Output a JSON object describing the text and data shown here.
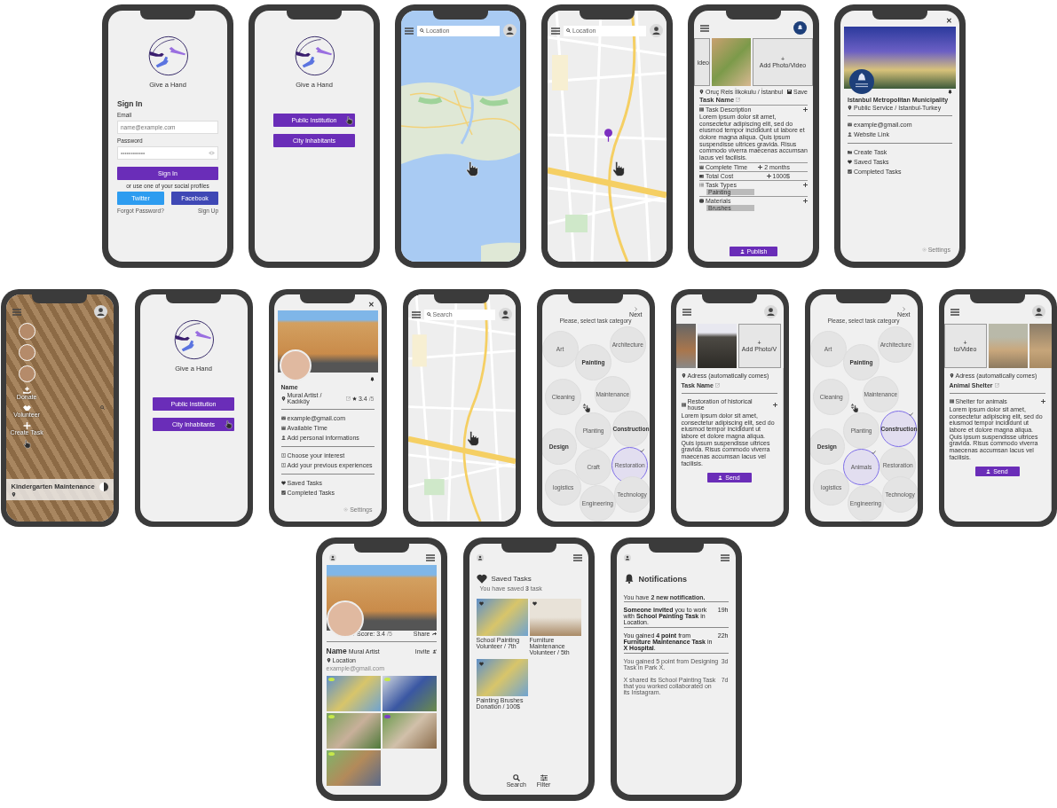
{
  "rows": [
    {
      "screens": [
        {
          "kind": "signin",
          "app_name": "Give a Hand",
          "heading": "Sign In",
          "email_label": "Email",
          "email_placeholder": "name@example.com",
          "password_label": "Password",
          "password_value": "••••••••••••",
          "submit": "Sign In",
          "social_text": "or use one of your social profiles",
          "twitter": "Twitter",
          "facebook": "Facebook",
          "forgot": "Forgot Password?",
          "signup": "Sign Up"
        },
        {
          "kind": "role",
          "app_name": "Give a Hand",
          "buttons": [
            {
              "label": "Public Institution",
              "pointer": true
            },
            {
              "label": "City Inhabitants",
              "pointer": false
            }
          ]
        },
        {
          "kind": "map",
          "search_placeholder": "Location",
          "street_level": false,
          "pin": false
        },
        {
          "kind": "map",
          "search_placeholder": "Location",
          "street_level": true,
          "pin": true
        },
        {
          "kind": "create_task",
          "side_text": "ideo",
          "plus": "+",
          "add_media": "Add Photo/Video",
          "address": "Oruç Reis İlkokulu / İstanbul",
          "save": "Save",
          "task_name": "Task Name",
          "publish": "Publish",
          "sections": [
            {
              "kind": "text",
              "title": "Task Description",
              "body": "Lorem ipsum dolor sit amet, consectetur adipiscing elit, sed do eiusmod tempor incididunt ut labore et dolore magna aliqua. Quis ipsum suspendisse ultrices gravida. Risus commodo viverra maecenas accumsan lacus vel facilisis."
            },
            {
              "kind": "value",
              "title": "Complete Time",
              "value": "2 months"
            },
            {
              "kind": "value",
              "title": "Total Cost",
              "value": "1000$"
            },
            {
              "kind": "tags",
              "title": "Task Types",
              "tags": [
                "Painting"
              ]
            },
            {
              "kind": "tags",
              "title": "Materials",
              "tags": [
                "Brushes"
              ]
            }
          ]
        },
        {
          "kind": "institution",
          "close": "✕",
          "name": "Istanbul Metropolitan Municipality",
          "location": "Public Service / Istanbul-Turkey",
          "contacts": [
            "example@gmail.com",
            "Website Link"
          ],
          "menu": [
            "Create Task",
            "Saved Tasks",
            "Completed Tasks"
          ],
          "settings": "Settings"
        }
      ]
    },
    {
      "screens": [
        {
          "kind": "feed",
          "actions": [
            "Donate",
            "Volunteer",
            "Create Task"
          ],
          "task_title": "Kindergarten Maintenance"
        },
        {
          "kind": "role",
          "app_name": "Give a Hand",
          "buttons": [
            {
              "label": "Public Institution",
              "pointer": false
            },
            {
              "label": "City Inhabitants",
              "pointer": true
            }
          ]
        },
        {
          "kind": "user_profile",
          "close": "✕",
          "name": "Name",
          "role": "Mural Artist / Kadıköy",
          "score": "3.4",
          "score_max": "/5",
          "groups": [
            {
              "items": [
                "example@gmail.com",
                "Available Time",
                "Add personal informations"
              ]
            },
            {
              "items": [
                "Choose your interest",
                "Add your previous experiences"
              ]
            },
            {
              "items": [
                "Saved Tasks",
                "Completed Tasks"
              ]
            }
          ],
          "settings": "Settings"
        },
        {
          "kind": "map",
          "search_placeholder": "Search",
          "street_level": true,
          "pin": false
        },
        {
          "kind": "categories",
          "title": "Please, select task category",
          "next": "Next",
          "categories": [
            {
              "label": "Art",
              "bold": false,
              "selected": false
            },
            {
              "label": "Painting",
              "bold": true,
              "selected": false
            },
            {
              "label": "Architecture",
              "bold": false,
              "selected": false
            },
            {
              "label": "Maintenance",
              "bold": false,
              "selected": false
            },
            {
              "label": "Cleaning",
              "bold": false,
              "selected": false
            },
            {
              "label": "Construction",
              "bold": true,
              "selected": false
            },
            {
              "label": "Planting",
              "bold": false,
              "selected": false
            },
            {
              "label": "Design",
              "bold": true,
              "selected": false
            },
            {
              "label": "Restoration",
              "bold": false,
              "selected": true
            },
            {
              "label": "Craft",
              "bold": false,
              "selected": false
            },
            {
              "label": "logistics",
              "bold": false,
              "selected": false
            },
            {
              "label": "Technology",
              "bold": false,
              "selected": false
            },
            {
              "label": "Engineering",
              "bold": false,
              "selected": false
            }
          ]
        },
        {
          "kind": "task_form",
          "tiles": [
            {
              "kind": "photo"
            },
            {
              "kind": "photo"
            },
            {
              "kind": "add",
              "plus": "+",
              "label": "Add Photo/V"
            }
          ],
          "address": "Adress (automatically comes)",
          "task_name": "Task Name",
          "description_title": "Restoration of historical house",
          "body": "Lorem ipsum dolor sit amet, consectetur adipiscing elit, sed do eiusmod tempor incididunt ut labore et dolore magna aliqua. Quis ipsum suspendisse ultrices gravida. Risus commodo viverra maecenas accumsan lacus vel facilisis.",
          "send": "Send"
        },
        {
          "kind": "categories",
          "title": "Please, select task category",
          "next": "Next",
          "categories": [
            {
              "label": "Art",
              "bold": false,
              "selected": false
            },
            {
              "label": "Painting",
              "bold": true,
              "selected": false
            },
            {
              "label": "Architecture",
              "bold": false,
              "selected": false
            },
            {
              "label": "Maintenance",
              "bold": false,
              "selected": false
            },
            {
              "label": "Cleaning",
              "bold": false,
              "selected": false
            },
            {
              "label": "Construction",
              "bold": true,
              "selected": true
            },
            {
              "label": "Planting",
              "bold": false,
              "selected": false
            },
            {
              "label": "Design",
              "bold": true,
              "selected": false
            },
            {
              "label": "Restoration",
              "bold": false,
              "selected": false
            },
            {
              "label": "Animals",
              "bold": false,
              "selected": true
            },
            {
              "label": "logistics",
              "bold": false,
              "selected": false
            },
            {
              "label": "Technology",
              "bold": false,
              "selected": false
            },
            {
              "label": "Engineering",
              "bold": false,
              "selected": false
            }
          ]
        },
        {
          "kind": "task_form",
          "tiles": [
            {
              "kind": "add",
              "plus": "+",
              "label": "to/Video"
            },
            {
              "kind": "photo"
            },
            {
              "kind": "photo"
            }
          ],
          "address": "Adress (automatically comes)",
          "task_name": "Animal Shelter",
          "description_title": "Shelter for animals",
          "body": "Lorem ipsum dolor sit amet, consectetur adipiscing elit, sed do eiusmod tempor incididunt ut labore et dolore magna aliqua. Quis ipsum suspendisse ultrices gravida. Risus commodo viverra maecenas accumsan lacus vel facilisis.",
          "send": "Send"
        }
      ]
    },
    {
      "screens": [
        {
          "kind": "portfolio",
          "score": "Score: 3.4",
          "score_max": "/5",
          "share": "Share",
          "name": "Name",
          "role": "Mural Artist",
          "invite": "Invite",
          "location": "Location",
          "email": "example@gmail.com",
          "photos": [
            {
              "color": "#c6e84a"
            },
            {
              "color": "#c6e84a"
            },
            {
              "color": "#c6e84a"
            },
            {
              "color": "#7b3fc4"
            },
            {
              "color": "#c6e84a"
            }
          ]
        },
        {
          "kind": "saved",
          "title": "Saved Tasks",
          "summary": "You have saved **3** task",
          "items": [
            {
              "caption": "School Painting Volunteer / 7th"
            },
            {
              "caption": "Furniture Maintenance Volunteer / 5th"
            },
            {
              "caption": "Painting Brushes Donation / 100$"
            }
          ],
          "nav": [
            "Search",
            "Filter"
          ]
        },
        {
          "kind": "notifications",
          "title": "Notifications",
          "summary": "You have **2 new notification.**",
          "items": [
            {
              "text": "**Someone invited** you to work with **School Painting Task** in Location.",
              "time": "19h",
              "unread": true
            },
            {
              "text": "You gained **4 point** from **Furniture Maintenance Task** in **X Hospital**.",
              "time": "22h",
              "unread": true
            },
            {
              "text": "You gained 5 point from Designing Task in Park X.",
              "time": "3d",
              "unread": false
            },
            {
              "text": "X shared its School Painting Task that you worked collaborated on its Instagram.",
              "time": "7d",
              "unread": false
            }
          ]
        }
      ]
    }
  ]
}
